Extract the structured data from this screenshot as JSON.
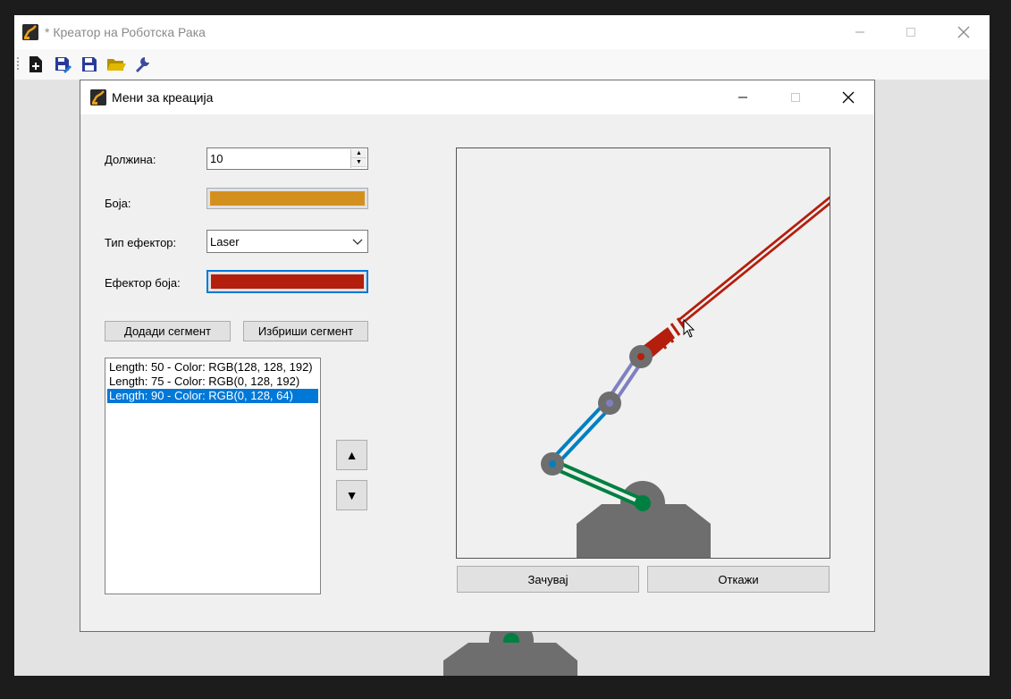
{
  "main_window": {
    "title": "* Креатор на Роботска Рака",
    "toolbar": [
      {
        "name": "new-file-icon"
      },
      {
        "name": "save-as-icon"
      },
      {
        "name": "save-icon"
      },
      {
        "name": "open-folder-icon"
      },
      {
        "name": "wrench-icon"
      }
    ]
  },
  "dialog": {
    "title": "Мени за креација",
    "length_label": "Должина:",
    "length_value": "10",
    "color_label": "Боја:",
    "color_value": "#d4901e",
    "effector_type_label": "Тип ефектор:",
    "effector_type_value": "Laser",
    "effector_color_label": "Ефектор боја:",
    "effector_color_value": "#b41e0c",
    "add_segment_label": "Додади сегмент",
    "delete_segment_label": "Избриши сегмент",
    "segments": [
      {
        "text": "Length: 50 - Color: RGB(128, 128, 192)",
        "selected": false
      },
      {
        "text": "Length: 75 - Color: RGB(0, 128, 192)",
        "selected": false
      },
      {
        "text": "Length: 90 - Color: RGB(0, 128, 64)",
        "selected": true
      }
    ],
    "move_up_label": "▲",
    "move_down_label": "▼",
    "save_label": "Зачувај",
    "cancel_label": "Откажи"
  },
  "colors": {
    "base": "#6e6e6e",
    "joint": "#6e6e6e",
    "segment_1": "#8080c0",
    "segment_2": "#0080c0",
    "segment_3": "#008040",
    "laser": "#b41e0c",
    "selection": "#0078d7"
  }
}
